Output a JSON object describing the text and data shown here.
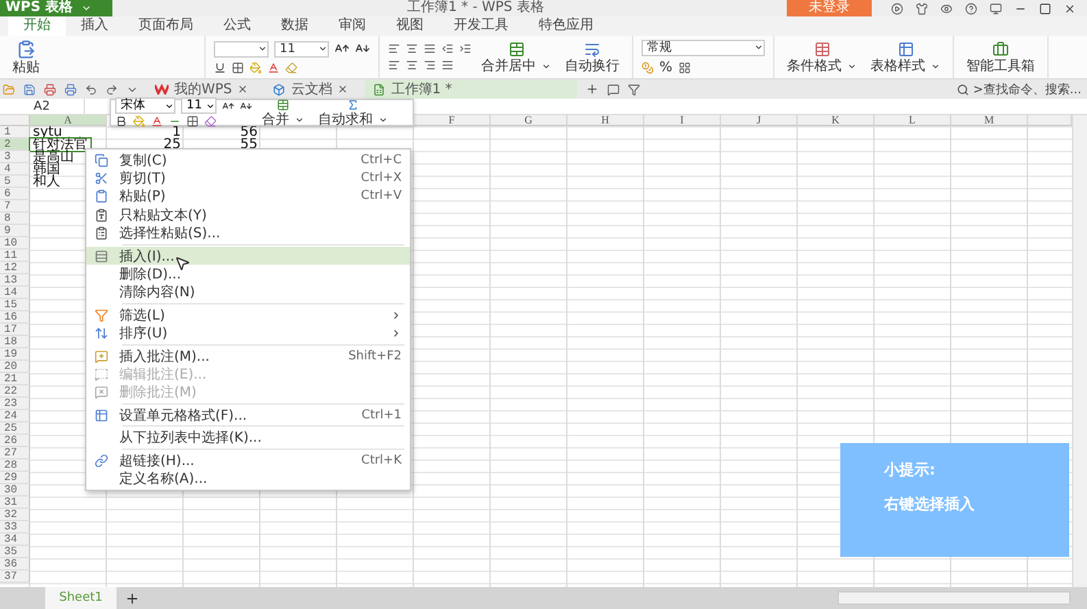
{
  "app_button": {
    "label": "WPS 表格"
  },
  "window": {
    "title": "工作簿1 * - WPS 表格",
    "login": "未登录"
  },
  "menu_tabs": [
    {
      "label": "开始",
      "selected": true
    },
    {
      "label": "插入",
      "selected": false
    },
    {
      "label": "页面布局",
      "selected": false
    },
    {
      "label": "公式",
      "selected": false
    },
    {
      "label": "数据",
      "selected": false
    },
    {
      "label": "审阅",
      "selected": false
    },
    {
      "label": "视图",
      "selected": false
    },
    {
      "label": "开发工具",
      "selected": false
    },
    {
      "label": "特色应用",
      "selected": false
    }
  ],
  "ribbon": {
    "paste": "粘贴",
    "font_size": "11",
    "merge": "合并居中",
    "wrap": "自动换行",
    "number_format": "常规",
    "percent": "%",
    "conditional": "条件格式",
    "table_style": "表格样式",
    "toolbox": "智能工具箱"
  },
  "doc_tabs": [
    {
      "label": "我的WPS",
      "selected": false
    },
    {
      "label": "云文档",
      "selected": false
    },
    {
      "label": "工作簿1 *",
      "selected": true
    }
  ],
  "command_search": {
    "placeholder": ">查找命令、搜索..."
  },
  "name_box": "A2",
  "mini_toolbar": {
    "font": "宋体",
    "size": "11",
    "merge": "合并",
    "autosum": "自动求和"
  },
  "columns": [
    {
      "label": "A",
      "selected": true
    },
    {
      "label": "F",
      "selected": false
    },
    {
      "label": "G",
      "selected": false
    },
    {
      "label": "H",
      "selected": false
    },
    {
      "label": "I",
      "selected": false
    },
    {
      "label": "J",
      "selected": false
    },
    {
      "label": "K",
      "selected": false
    },
    {
      "label": "L",
      "selected": false
    },
    {
      "label": "M",
      "selected": false
    }
  ],
  "rows": [
    {
      "number": "1",
      "selected": false,
      "cells": [
        {
          "text": "sytu",
          "kind": "text"
        },
        {
          "text": "1",
          "kind": "number"
        },
        {
          "text": "56",
          "kind": "number"
        }
      ]
    },
    {
      "number": "2",
      "selected": true,
      "cells": [
        {
          "text": "针对法官",
          "kind": "text",
          "selected": true
        },
        {
          "text": "25",
          "kind": "number"
        },
        {
          "text": "55",
          "kind": "number"
        }
      ]
    },
    {
      "number": "3",
      "selected": false,
      "cells": [
        {
          "text": "是高山",
          "kind": "text"
        }
      ]
    },
    {
      "number": "4",
      "selected": false,
      "cells": [
        {
          "text": "韩国",
          "kind": "text"
        }
      ]
    },
    {
      "number": "5",
      "selected": false,
      "cells": [
        {
          "text": "和人",
          "kind": "text"
        }
      ]
    },
    {
      "number": "6",
      "selected": false
    },
    {
      "number": "7",
      "selected": false
    },
    {
      "number": "8",
      "selected": false
    },
    {
      "number": "9",
      "selected": false
    },
    {
      "number": "10",
      "selected": false
    },
    {
      "number": "11",
      "selected": false
    },
    {
      "number": "12",
      "selected": false
    },
    {
      "number": "13",
      "selected": false
    },
    {
      "number": "14",
      "selected": false
    },
    {
      "number": "15",
      "selected": false
    },
    {
      "number": "16",
      "selected": false
    },
    {
      "number": "17",
      "selected": false
    },
    {
      "number": "18",
      "selected": false
    },
    {
      "number": "19",
      "selected": false
    },
    {
      "number": "20",
      "selected": false
    },
    {
      "number": "21",
      "selected": false
    },
    {
      "number": "22",
      "selected": false
    },
    {
      "number": "23",
      "selected": false
    },
    {
      "number": "24",
      "selected": false
    },
    {
      "number": "25",
      "selected": false
    },
    {
      "number": "26",
      "selected": false
    },
    {
      "number": "27",
      "selected": false
    },
    {
      "number": "28",
      "selected": false
    },
    {
      "number": "29",
      "selected": false
    },
    {
      "number": "30",
      "selected": false
    },
    {
      "number": "31",
      "selected": false
    },
    {
      "number": "32",
      "selected": false
    },
    {
      "number": "33",
      "selected": false
    },
    {
      "number": "34",
      "selected": false
    },
    {
      "number": "35",
      "selected": false
    },
    {
      "number": "36",
      "selected": false
    },
    {
      "number": "37",
      "selected": false
    }
  ],
  "context_menu": [
    [
      {
        "label": "复制(C)",
        "shortcut": "Ctrl+C",
        "selected": false,
        "disabled": false,
        "submenu": false
      },
      {
        "label": "剪切(T)",
        "shortcut": "Ctrl+X",
        "selected": false,
        "disabled": false,
        "submenu": false
      },
      {
        "label": "粘贴(P)",
        "shortcut": "Ctrl+V",
        "selected": false,
        "disabled": false,
        "submenu": false
      },
      {
        "label": "只粘贴文本(Y)",
        "selected": false,
        "disabled": false,
        "submenu": false
      },
      {
        "label": "选择性粘贴(S)...",
        "selected": false,
        "disabled": false,
        "submenu": false
      }
    ],
    [
      {
        "label": "插入(I)...",
        "selected": true,
        "disabled": false,
        "submenu": false
      },
      {
        "label": "删除(D)...",
        "selected": false,
        "disabled": false,
        "submenu": false
      },
      {
        "label": "清除内容(N)",
        "selected": false,
        "disabled": false,
        "submenu": false
      }
    ],
    [
      {
        "label": "筛选(L)",
        "selected": false,
        "disabled": false,
        "submenu": true
      },
      {
        "label": "排序(U)",
        "selected": false,
        "disabled": false,
        "submenu": true
      }
    ],
    [
      {
        "label": "插入批注(M)...",
        "shortcut": "Shift+F2",
        "selected": false,
        "disabled": false,
        "submenu": false
      },
      {
        "label": "编辑批注(E)...",
        "selected": false,
        "disabled": true,
        "submenu": false
      },
      {
        "label": "删除批注(M)",
        "selected": false,
        "disabled": true,
        "submenu": false
      }
    ],
    [
      {
        "label": "设置单元格格式(F)...",
        "shortcut": "Ctrl+1",
        "selected": false,
        "disabled": false,
        "submenu": false
      }
    ],
    [
      {
        "label": "从下拉列表中选择(K)...",
        "selected": false,
        "disabled": false,
        "submenu": false
      }
    ],
    [
      {
        "label": "超链接(H)...",
        "shortcut": "Ctrl+K",
        "selected": false,
        "disabled": false,
        "submenu": false
      },
      {
        "label": "定义名称(A)...",
        "selected": false,
        "disabled": false,
        "submenu": false
      }
    ]
  ],
  "hint": {
    "title": "小提示:",
    "text": "右键选择插入"
  },
  "sheet_tabs": [
    {
      "label": "Sheet1",
      "selected": true
    }
  ]
}
